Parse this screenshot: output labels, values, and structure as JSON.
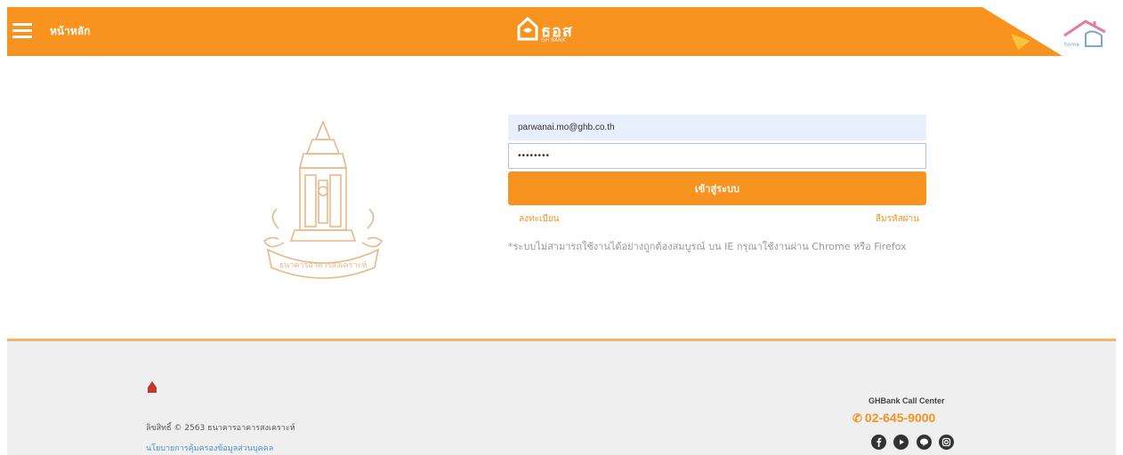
{
  "header": {
    "home_label": "หน้าหลัก",
    "brand_text": "ธอส",
    "brand_sub": "GH BANK"
  },
  "login": {
    "email_value": "parwanai.mo@ghb.co.th",
    "password_value": "••••••••",
    "submit_label": "เข้าสู่ระบบ",
    "register_link": "ลงทะเบียน",
    "forgot_link": "ลืมรหัสผ่าน",
    "browser_note": "*ระบบไม่สามารถใช้งานได้อย่างถูกต้องสมบูรณ์ บน IE กรุณาใช้งานผ่าน Chrome หรือ Firefox"
  },
  "footer": {
    "copyright": "ลิขสิทธิ์ © 2563 ธนาคารอาคารสงเคราะห์",
    "privacy_link": "นโยบายการคุ้มครองข้อมูลส่วนบุคคล",
    "callcenter_label": "GHBank Call Center",
    "phone": "02-645-9000",
    "social_icons": [
      "facebook-icon",
      "youtube-icon",
      "line-icon",
      "instagram-icon"
    ]
  },
  "colors": {
    "brand_orange": "#f7931e",
    "footer_bg": "#efefef",
    "link_blue": "#4a90c8"
  }
}
